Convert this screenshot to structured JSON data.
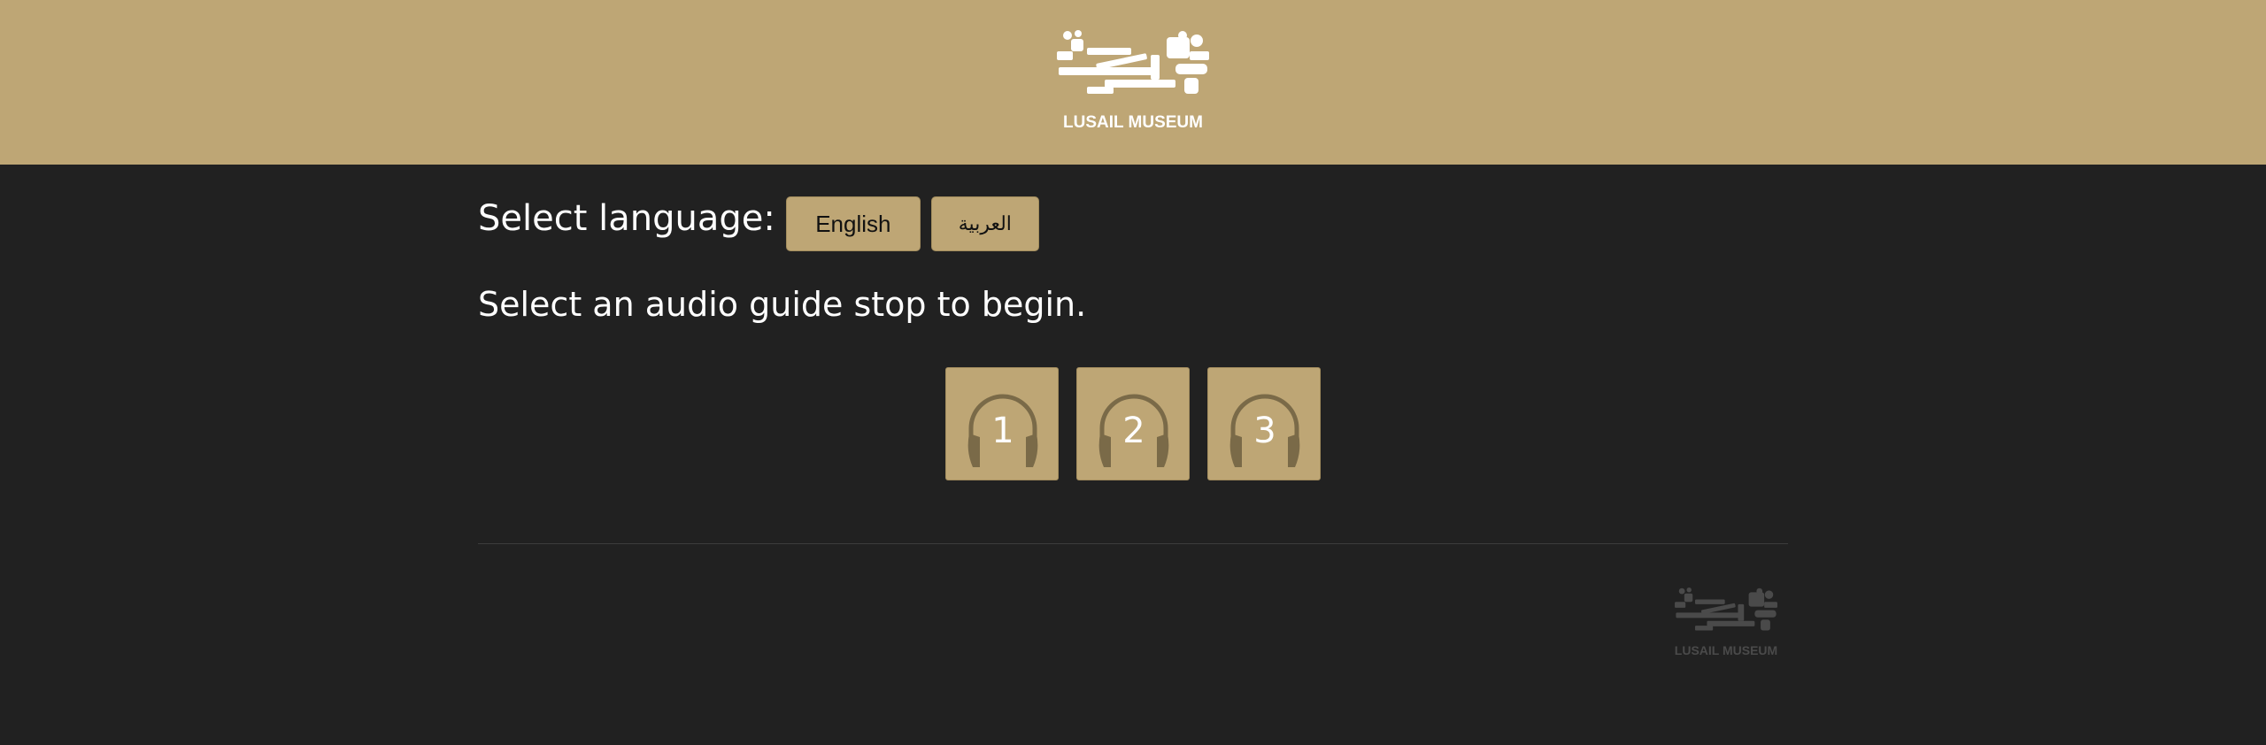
{
  "header": {
    "logo_icon": "lusail-museum-logo",
    "logo_text": "LUSAIL MUSEUM"
  },
  "language": {
    "label": "Select language:",
    "options": [
      "English",
      "العربية"
    ]
  },
  "intro_text": "Select an audio guide stop to begin.",
  "stops": {
    "icon": "headphones-icon",
    "items": [
      "1",
      "2",
      "3"
    ]
  },
  "footer": {
    "logo_icon": "lusail-museum-logo",
    "logo_text": "LUSAIL MUSEUM"
  },
  "colors": {
    "accent": "#bea675",
    "background": "#212121",
    "icon_dark": "#7a6a48"
  }
}
